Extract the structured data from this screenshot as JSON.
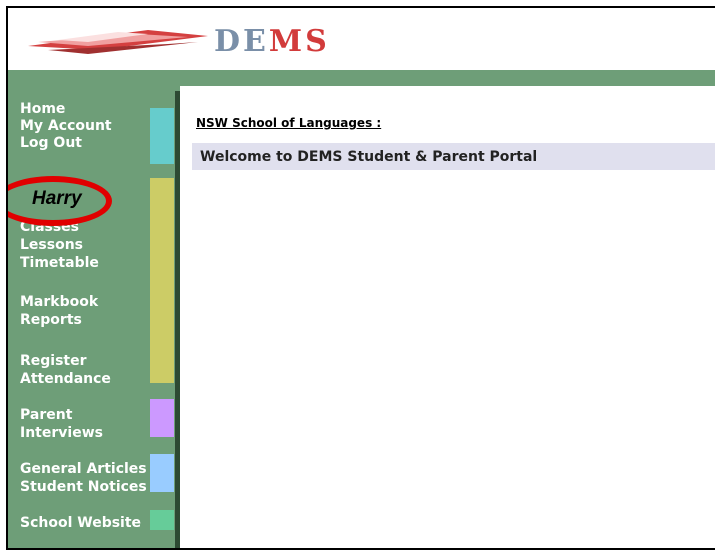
{
  "app": {
    "logo_text_left": "DE",
    "logo_text_right": "MS"
  },
  "sidebar": {
    "items": [
      {
        "label": "Home"
      },
      {
        "label": "My Account"
      },
      {
        "label": "Log Out"
      },
      {
        "label": "Classes"
      },
      {
        "label": "Lessons"
      },
      {
        "label": "Timetable"
      },
      {
        "label": "Markbook"
      },
      {
        "label": "Reports"
      },
      {
        "label": "Register"
      },
      {
        "label": "Attendance"
      },
      {
        "label": "Parent"
      },
      {
        "label": "Interviews"
      },
      {
        "label": "General Articles"
      },
      {
        "label": "Student Notices"
      },
      {
        "label": "School Website"
      }
    ],
    "user_name": "Harry",
    "swatch_colors": {
      "account": "#66cccc",
      "main": "#cccc66",
      "interviews": "#cc99ff",
      "articles": "#99ccff",
      "website": "#66cc99"
    }
  },
  "main": {
    "org_title": "NSW School of Languages :",
    "welcome": "Welcome to DEMS Student & Parent Portal"
  },
  "colors": {
    "green": "#6e9e78",
    "annotation": "#e00000"
  }
}
